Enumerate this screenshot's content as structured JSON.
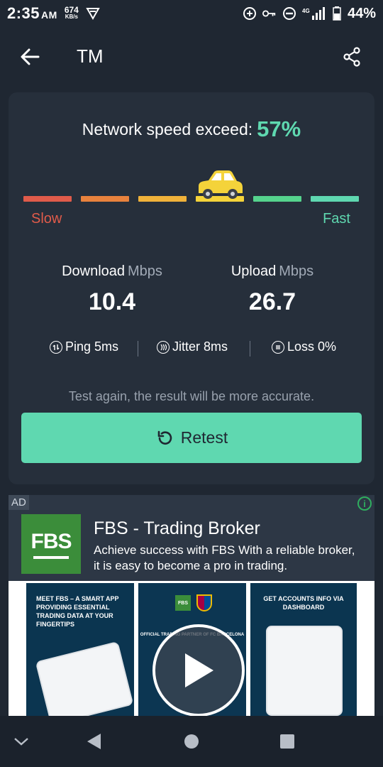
{
  "status_bar": {
    "time": "2:35",
    "ampm": "AM",
    "net_speed": "674",
    "net_unit": "KB/s",
    "network_type": "4G",
    "battery": "44%"
  },
  "app_bar": {
    "title": "TM",
    "back_icon": "arrow-left-icon",
    "share_icon": "share-icon"
  },
  "result": {
    "headline": "Network speed exceed:",
    "percent": "57%",
    "percentile_value": 0.57,
    "speed_labels": {
      "slow": "Slow",
      "fast": "Fast"
    },
    "gauge_colors": [
      "#e05b4a",
      "#e8823d",
      "#f0b23a",
      "#f4d33a",
      "#55d38d",
      "#5fd8b0"
    ],
    "active_segment": 4,
    "download": {
      "label": "Download",
      "unit": "Mbps",
      "value": "10.4"
    },
    "upload": {
      "label": "Upload",
      "unit": "Mbps",
      "value": "26.7"
    },
    "ping": "Ping 5ms",
    "jitter": "Jitter 8ms",
    "loss": "Loss 0%",
    "hint": "Test again, the result will be more accurate.",
    "retest_label": "Retest"
  },
  "ad": {
    "badge": "AD",
    "info_icon": "info-icon",
    "logo_text": "FBS",
    "title": "FBS - Trading Broker",
    "description": "Achieve success with FBS With a reliable broker, it is easy to become a pro in trading.",
    "panel1_text": "MEET FBS – A SMART APP PROVIDING ESSENTIAL TRADING DATA AT YOUR FINGERTIPS",
    "panel2_text": "OFFICIAL TRADING PARTNER OF FC BARCELONA",
    "panel3_text": "GET ACCOUNTS INFO VIA DASHBOARD"
  },
  "colors": {
    "accent": "#5fd8b0",
    "background": "#1f2732",
    "card": "#262f3b",
    "slow": "#e05b4a"
  }
}
